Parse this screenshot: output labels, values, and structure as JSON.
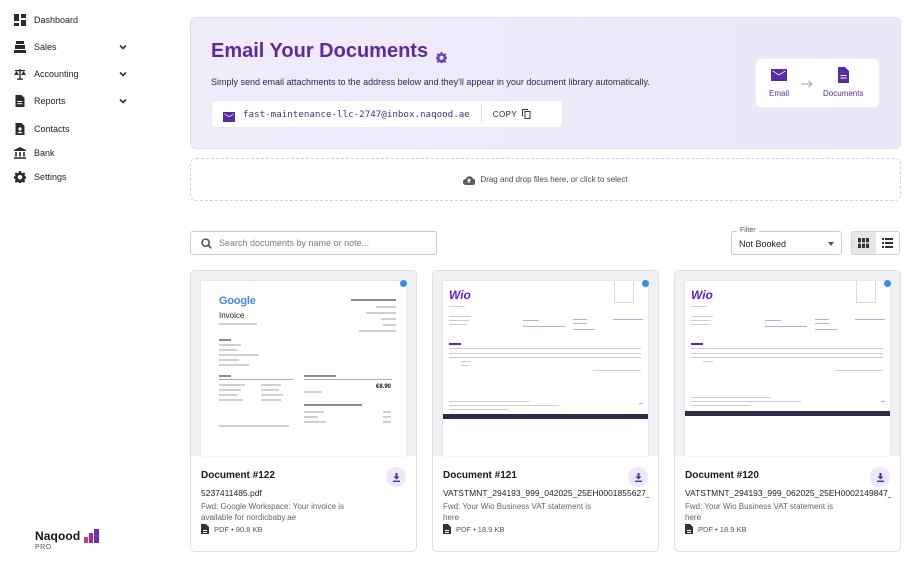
{
  "sidebar": {
    "items": [
      {
        "label": "Dashboard",
        "icon": "dashboard-icon",
        "expandable": false
      },
      {
        "label": "Sales",
        "icon": "sales-icon",
        "expandable": true
      },
      {
        "label": "Accounting",
        "icon": "scale-icon",
        "expandable": true
      },
      {
        "label": "Reports",
        "icon": "report-icon",
        "expandable": true
      },
      {
        "label": "Contacts",
        "icon": "contacts-icon",
        "expandable": false
      },
      {
        "label": "Bank",
        "icon": "bank-icon",
        "expandable": false
      },
      {
        "label": "Settings",
        "icon": "gear-icon",
        "expandable": false
      }
    ]
  },
  "brand": {
    "name": "Naqood",
    "tier": "PRO"
  },
  "hero": {
    "title": "Email Your Documents",
    "subtitle": "Simply send email attachments to the address below and they'll appear in your document library automatically.",
    "email_address": "fast-maintenance-llc-2747@inbox.naqood.ae",
    "copy_label": "COPY",
    "flow": {
      "from_label": "Email",
      "to_label": "Documents"
    }
  },
  "dropzone": {
    "text": "Drag and drop files here, or click to select"
  },
  "toolbar": {
    "search_placeholder": "Search documents by name or note...",
    "filter_label": "Filter",
    "filter_value": "Not Booked",
    "view_mode": "grid"
  },
  "documents": [
    {
      "title": "Document #122",
      "filename": "5237411485.pdf",
      "note": "Fwd: Google Workspace: Your invoice is available for nordicbaby.ae",
      "meta": "PDF • 90.8 KB",
      "preview": "google",
      "preview_logo": "Google",
      "preview_heading": "Invoice",
      "preview_amount": "€8.90",
      "unread": true
    },
    {
      "title": "Document #121",
      "filename": "VATSTMNT_294193_999_042025_25EH0001855627_",
      "note": "Fwd: Your Wio Business VAT statement is here",
      "meta": "PDF • 18.9 KB",
      "preview": "wio",
      "preview_logo": "Wio",
      "unread": true
    },
    {
      "title": "Document #120",
      "filename": "VATSTMNT_294193_999_062025_25EH0002149847_",
      "note": "Fwd: Your Wio Business VAT statement is here",
      "meta": "PDF • 18.9 KB",
      "preview": "wio",
      "preview_logo": "Wio",
      "unread": true
    }
  ],
  "colors": {
    "accent": "#5b2aa6",
    "unread_dot": "#2d8ef2",
    "hero_bg": "#efebf9"
  }
}
